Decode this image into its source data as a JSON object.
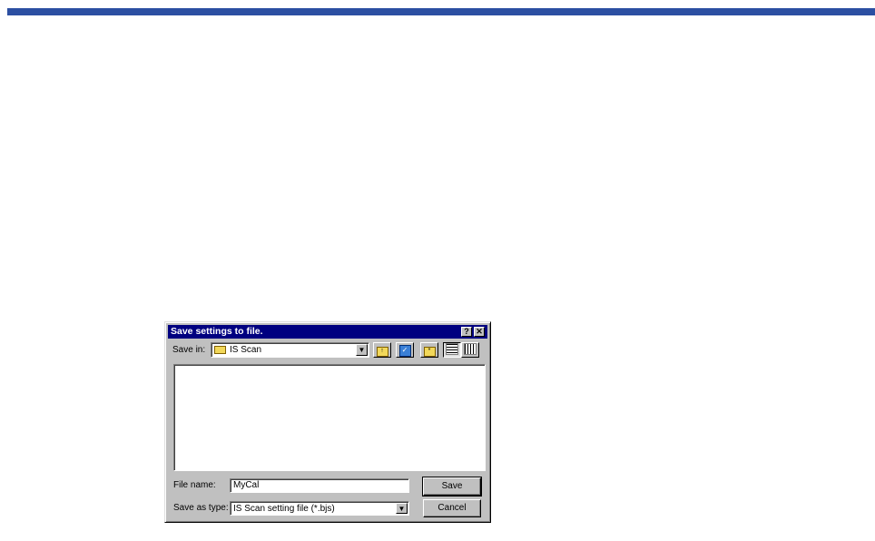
{
  "dialog": {
    "title": "Save settings to file.",
    "help_label": "?",
    "close_label": "✕",
    "save_in_label": "Save in:",
    "save_in_value": "IS Scan",
    "file_name_label": "File name:",
    "file_name_value": "MyCal",
    "save_as_type_label": "Save as type:",
    "save_as_type_value": "IS Scan setting file (*.bjs)",
    "save_button": "Save",
    "cancel_button": "Cancel",
    "dropdown_arrow": "▼"
  },
  "colors": {
    "top_bar": "#2c4fa2",
    "titlebar": "#000080",
    "dialog_face": "#c0c0c0"
  }
}
